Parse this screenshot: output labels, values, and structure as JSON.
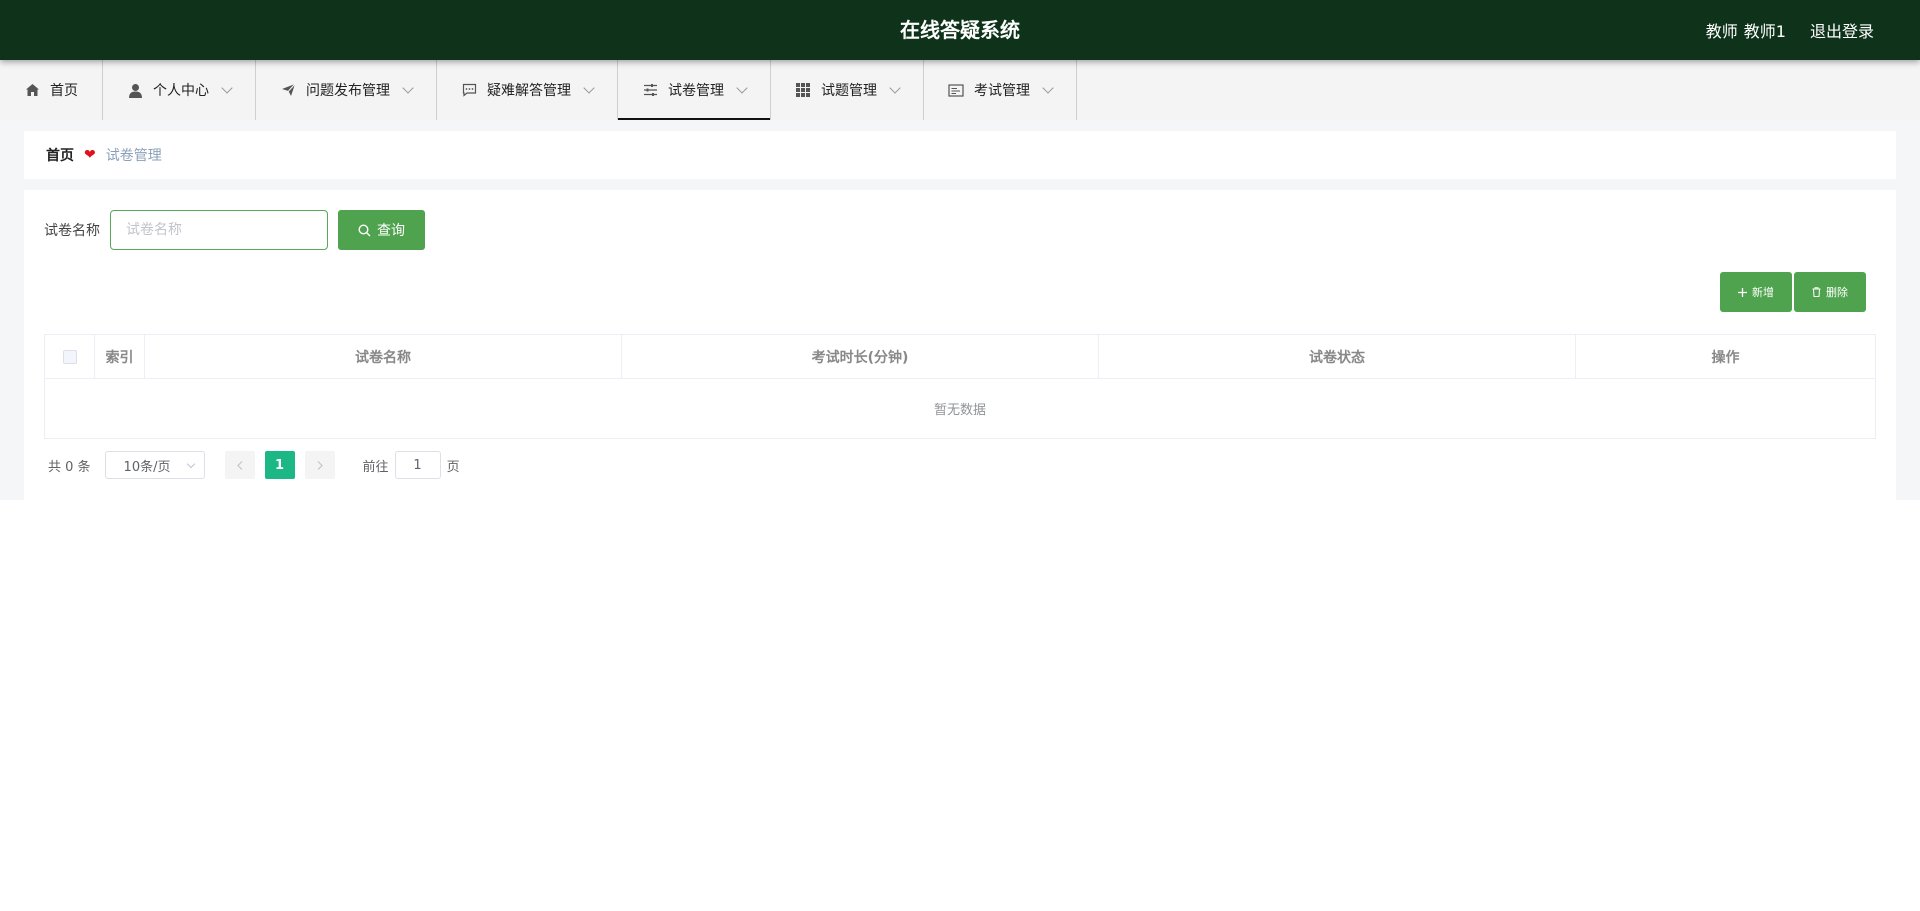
{
  "header": {
    "title": "在线答疑系统",
    "user_role": "教师",
    "user_name": "教师1",
    "logout_label": "退出登录",
    "bg_color": "#0e331a"
  },
  "nav": {
    "items": [
      {
        "label": "首页",
        "icon": "home-icon"
      },
      {
        "label": "个人中心",
        "icon": "user-icon"
      },
      {
        "label": "问题发布管理",
        "icon": "send-icon"
      },
      {
        "label": "疑难解答管理",
        "icon": "chat-icon"
      },
      {
        "label": "试卷管理",
        "icon": "sliders-icon",
        "active": true
      },
      {
        "label": "试题管理",
        "icon": "grid-icon"
      },
      {
        "label": "考试管理",
        "icon": "tablet-icon"
      }
    ]
  },
  "breadcrumb": {
    "home": "首页",
    "current": "试卷管理"
  },
  "search": {
    "label": "试卷名称",
    "placeholder": "试卷名称",
    "value": "",
    "button_label": "查询"
  },
  "actions": {
    "add_label": "新增",
    "delete_label": "删除"
  },
  "table": {
    "columns": [
      "索引",
      "试卷名称",
      "考试时长(分钟)",
      "试卷状态",
      "操作"
    ],
    "empty_text": "暂无数据"
  },
  "pagination": {
    "total": "共 0 条",
    "page_size": "10条/页",
    "current_page": "1",
    "goto_prefix": "前往",
    "goto_value": "1",
    "goto_suffix": "页"
  },
  "colors": {
    "accent": "#4fa34f",
    "page_active": "#1bb785"
  }
}
